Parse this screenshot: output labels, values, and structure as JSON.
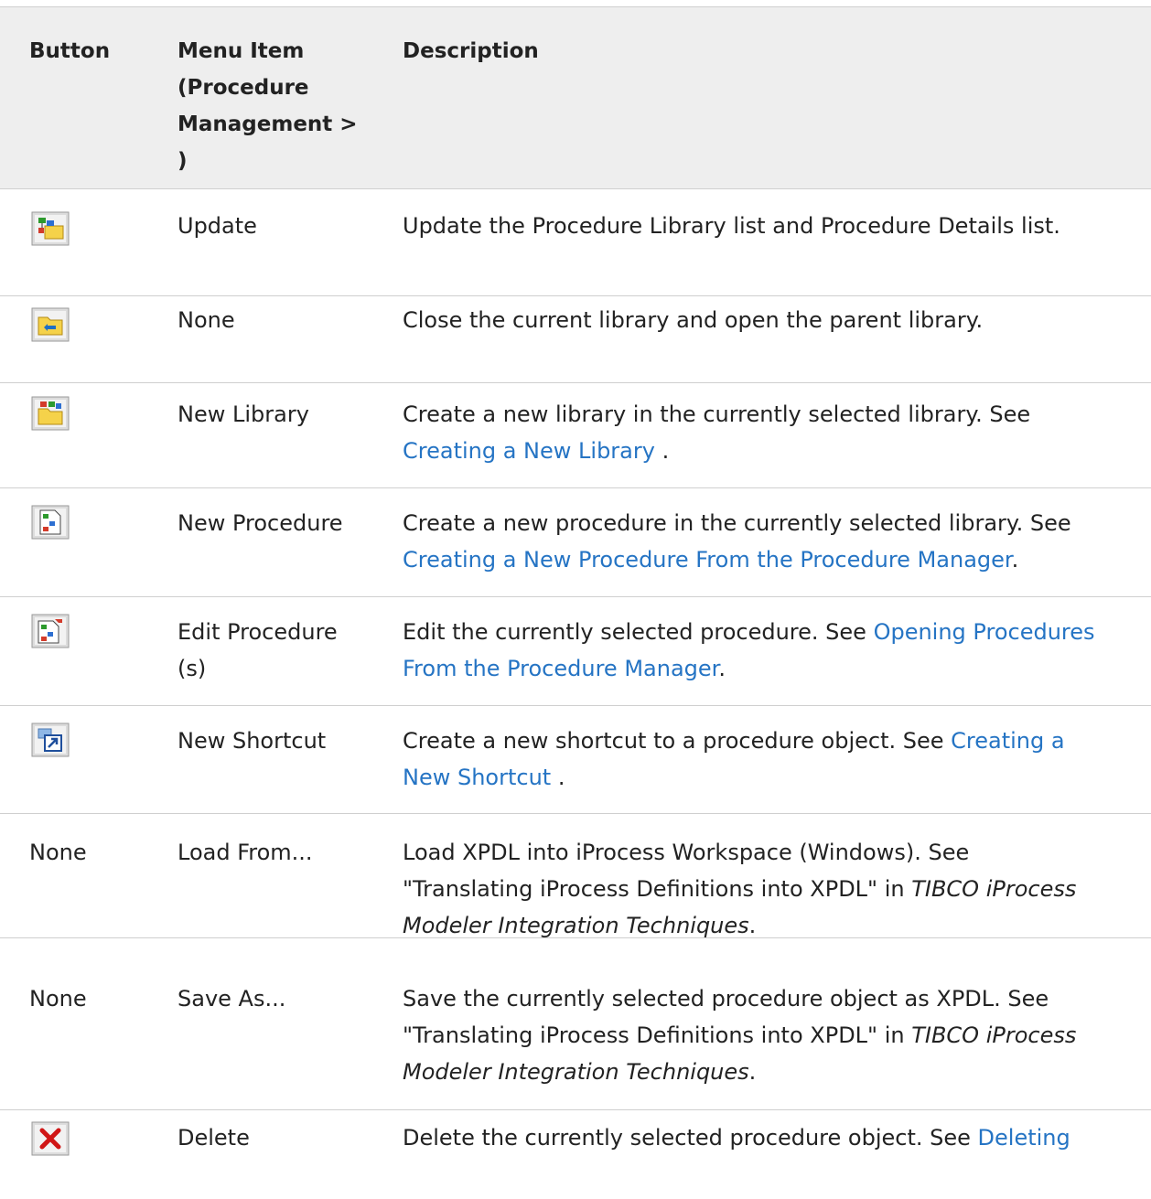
{
  "header": {
    "col_button": "Button",
    "col_menu_line1": "Menu Item",
    "col_menu_line2": "(Procedure",
    "col_menu_line3": "Management >",
    "col_menu_line4": ")",
    "col_description": "Description"
  },
  "rows": [
    {
      "button_icon": "update-icon",
      "menu": "Update",
      "desc": "Update the Procedure Library list and Procedure Details list."
    },
    {
      "button_icon": "parent-library-icon",
      "menu": "None",
      "desc": "Close the current library and open the parent library."
    },
    {
      "button_icon": "new-library-icon",
      "menu": "New Library",
      "desc": "Create a new library in the currently selected library. See",
      "link": "Creating a New Library",
      "after": " ."
    },
    {
      "button_icon": "new-procedure-icon",
      "menu": "New Procedure",
      "desc": "Create a new procedure in the currently selected library. See",
      "link": "Creating a New Procedure From the Procedure Manager",
      "after": "."
    },
    {
      "button_icon": "edit-procedure-icon",
      "menu_line1": "Edit Procedure",
      "menu_line2": "(s)",
      "desc": "Edit the currently selected procedure. See",
      "link1": "Opening Procedures",
      "link2": "From the Procedure Manager",
      "after": "."
    },
    {
      "button_icon": "new-shortcut-icon",
      "menu": "New Shortcut",
      "desc": "Create a new shortcut to a procedure object. See",
      "link1": "Creating a",
      "link2": "New Shortcut",
      "after": " ."
    },
    {
      "button": "None",
      "menu": "Load From...",
      "desc_line1": "Load XPDL into iProcess Workspace (Windows). See",
      "desc_line2a": "\"Translating iProcess Definitions into XPDL\" in ",
      "desc_line2b": "TIBCO iProcess",
      "desc_line3": "Modeler Integration Techniques",
      "after": "."
    },
    {
      "button": "None",
      "menu": "Save As...",
      "desc_line1": "Save the currently selected procedure object as XPDL. See",
      "desc_line2a": "\"Translating iProcess Definitions into XPDL\" in ",
      "desc_line2b": "TIBCO iProcess",
      "desc_line3": "Modeler Integration Techniques",
      "after": "."
    },
    {
      "button_icon": "delete-icon",
      "menu": "Delete",
      "desc": "Delete the currently selected procedure object. See",
      "link": "Deleting"
    }
  ]
}
